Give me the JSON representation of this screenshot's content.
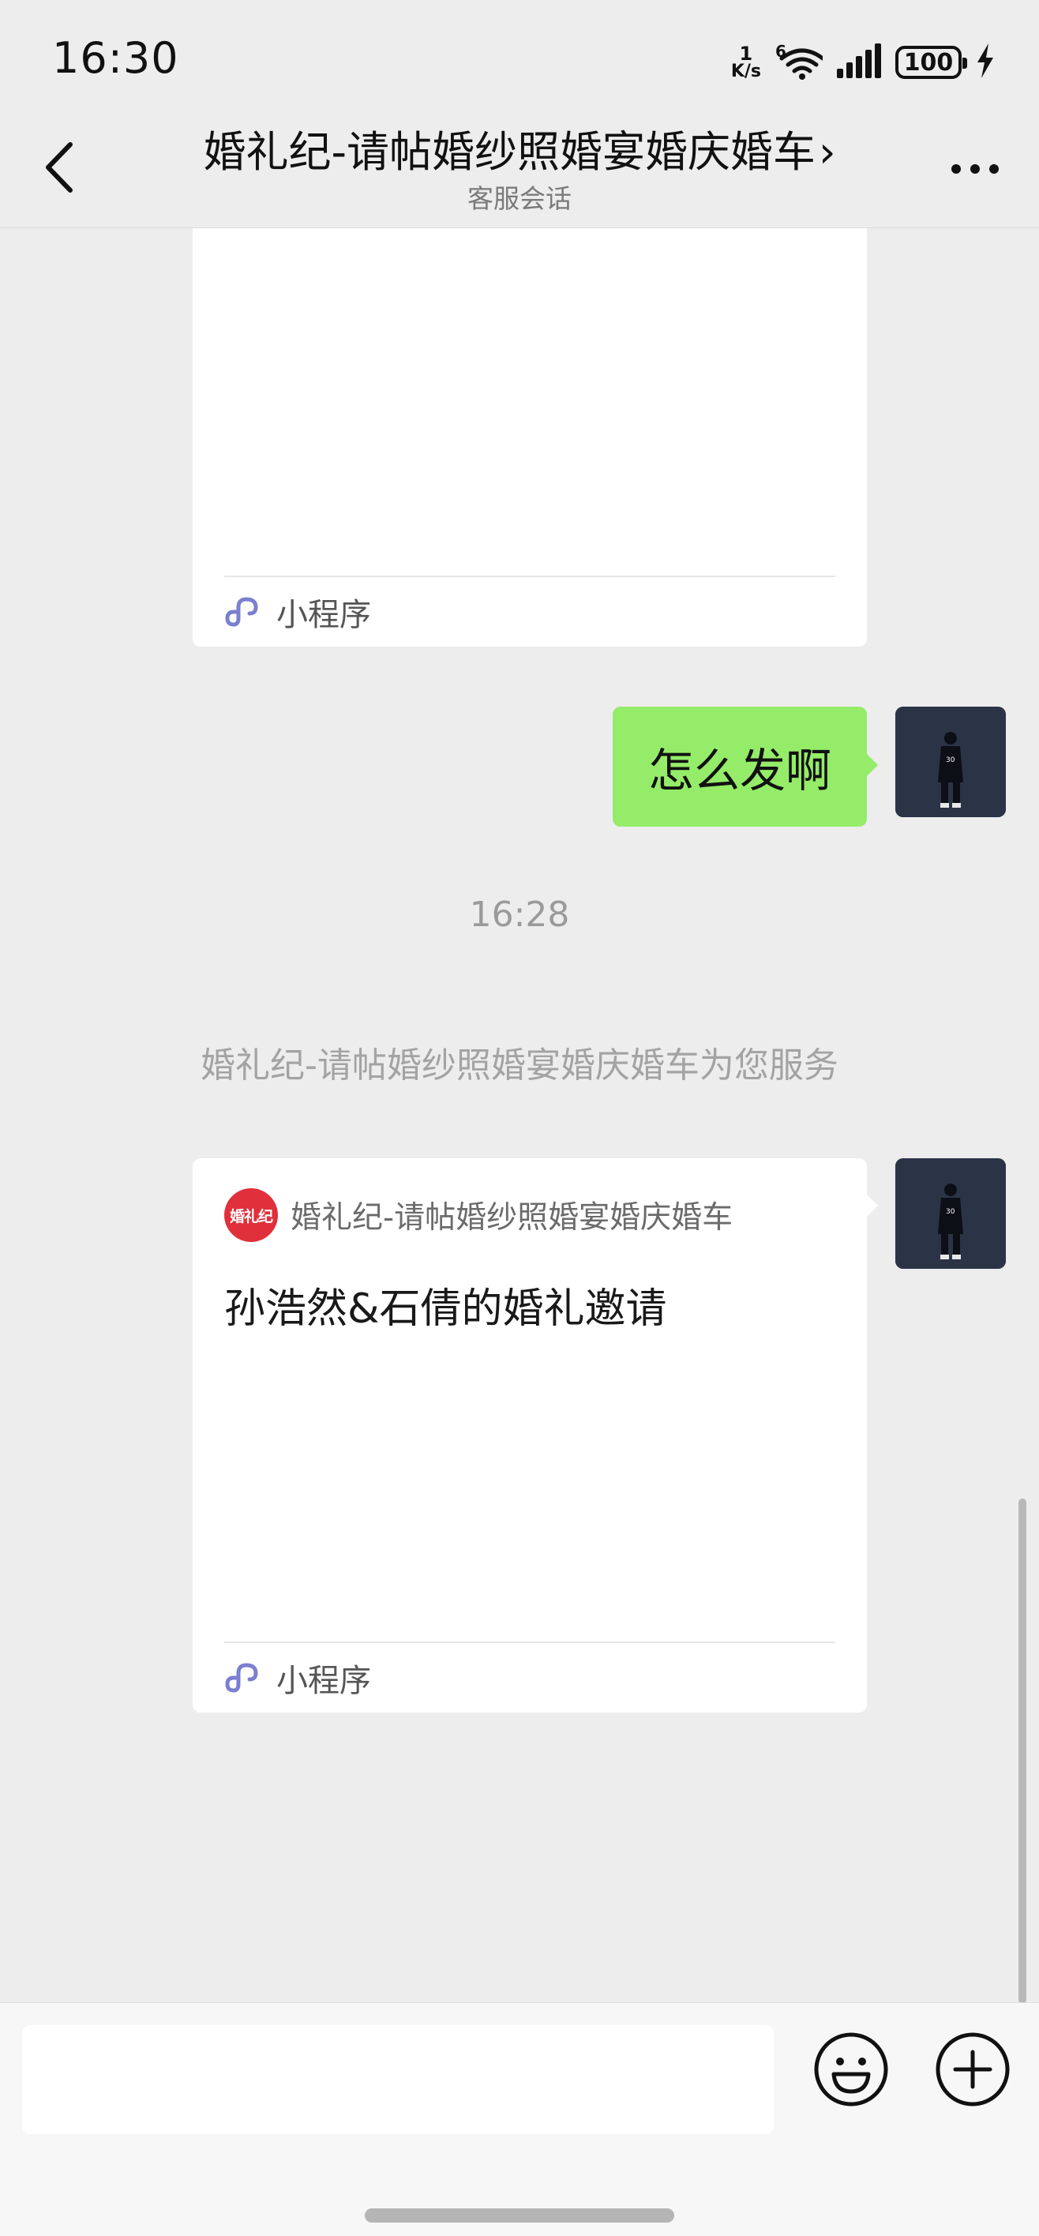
{
  "status_bar": {
    "time": "16:30",
    "net_speed_value": "1",
    "net_speed_unit": "K/s",
    "wifi_badge": "6",
    "battery_level": "100",
    "icons": [
      "wifi-icon",
      "signal-icon",
      "battery-icon",
      "charging-icon"
    ]
  },
  "nav": {
    "title": "婚礼纪-请帖婚纱照婚宴婚庆婚车",
    "chevron": "›",
    "subtitle": "客服会话"
  },
  "messages": {
    "top_card": {
      "footer_label": "小程序"
    },
    "user_message": {
      "text": "怎么发啊"
    },
    "timestamp": "16:28",
    "system_notice": "婚礼纪-请帖婚纱照婚宴婚庆婚车为您服务",
    "invite_card": {
      "logo_text": "婚礼纪",
      "brand_name": "婚礼纪-请帖婚纱照婚宴婚庆婚车",
      "title": "孙浩然&石倩的婚礼邀请",
      "footer_label": "小程序"
    }
  },
  "colors": {
    "background": "#ededed",
    "bubble_green": "#95ec69",
    "brand_red": "#e0303b",
    "miniprogram_icon": "#7b7fcf"
  }
}
